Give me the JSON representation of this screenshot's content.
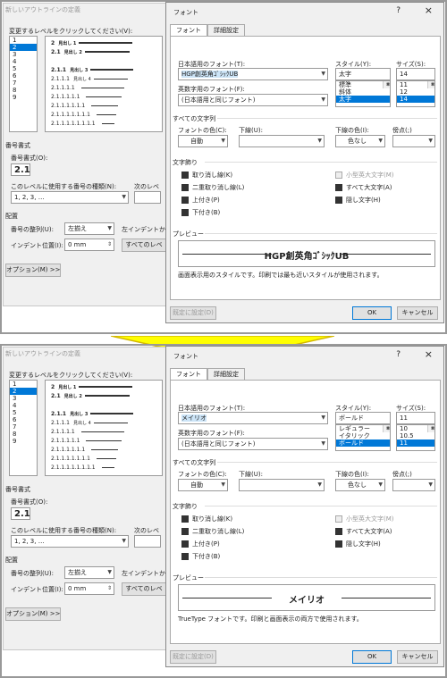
{
  "panels": [
    {
      "bg": {
        "title": "新しいアウトラインの定義",
        "level_prompt": "変更するレベルをクリックしてください(V):",
        "levels": [
          "1",
          "2",
          "3",
          "4",
          "5",
          "6",
          "7",
          "8",
          "9"
        ],
        "selected_level": 1,
        "preview_lines": [
          {
            "num": "2",
            "text": "見出し 1",
            "bold": true
          },
          {
            "num": "2.1",
            "text": "見出し 2",
            "bold": true
          },
          {
            "num": "",
            "text": "",
            "bold": false
          },
          {
            "num": "2.1.1",
            "text": "見出し 3",
            "bold": true
          },
          {
            "num": "2.1.1.1",
            "text": "見出し 4",
            "bold": false
          },
          {
            "num": "2.1.1.1.1",
            "text": "",
            "bold": false
          },
          {
            "num": "2.1.1.1.1.1",
            "text": "",
            "bold": false
          },
          {
            "num": "2.1.1.1.1.1.1",
            "text": "",
            "bold": false
          },
          {
            "num": "2.1.1.1.1.1.1.1",
            "text": "",
            "bold": false
          },
          {
            "num": "2.1.1.1.1.1.1.1.1",
            "text": "",
            "bold": false
          }
        ],
        "num_format_heading": "番号書式",
        "num_format_label": "番号書式(O):",
        "num_format_value": "2.1",
        "num_style_label": "このレベルに使用する番号の種類(N):",
        "next_level_label": "次のレベ",
        "num_style_value": "1, 2, 3, …",
        "placement_heading": "配置",
        "align_label": "番号の整列(U):",
        "align_value": "左揃え",
        "indent_from_label": "左インデントから",
        "indent_label": "インデント位置(I):",
        "indent_value": "0 mm",
        "all_levels_btn": "すべてのレベ",
        "options_btn": "オプション(M) >>"
      },
      "font": {
        "title": "フォント",
        "help": "?",
        "close": "×",
        "tabs": [
          "フォント",
          "詳細設定"
        ],
        "jp_font_label": "日本語用のフォント(T):",
        "jp_font_value": "HGP創英角ｺﾞｼｯｸUB",
        "latin_font_label": "英数字用のフォント(F):",
        "latin_font_value": "(日本語用と同じフォント)",
        "style_label": "スタイル(Y):",
        "style_value": "太字",
        "style_options": [
          "標準",
          "斜体",
          "太字"
        ],
        "style_selected": 2,
        "size_label": "サイズ(S):",
        "size_value": "14",
        "size_options": [
          "11",
          "12",
          "14"
        ],
        "size_selected": 2,
        "all_text_heading": "すべての文字列",
        "color_label": "フォントの色(C):",
        "color_value": "自動",
        "underline_label": "下線(U):",
        "underline_value": "",
        "ul_color_label": "下線の色(I):",
        "ul_color_value": "色なし",
        "emph_label": "傍点(;)",
        "emph_value": "",
        "effects_heading": "文字飾り",
        "effects": [
          {
            "label": "取り消し線(K)",
            "checked": true,
            "disabled": false
          },
          {
            "label": "二重取り消し線(L)",
            "checked": true,
            "disabled": false
          },
          {
            "label": "上付き(P)",
            "checked": true,
            "disabled": false
          },
          {
            "label": "下付き(B)",
            "checked": true,
            "disabled": false
          }
        ],
        "effects_right": [
          {
            "label": "小型英大文字(M)",
            "checked": false,
            "disabled": true
          },
          {
            "label": "すべて大文字(A)",
            "checked": true,
            "disabled": false
          },
          {
            "label": "隠し文字(H)",
            "checked": true,
            "disabled": false
          }
        ],
        "preview_heading": "プレビュー",
        "preview_text": "HGP創英角ｺﾞｼｯｸUB",
        "note": "画面表示用のスタイルです。印刷では最も近いスタイルが使用されます。",
        "default_btn": "既定に設定(D)",
        "ok_btn": "OK",
        "cancel_btn": "キャンセル"
      }
    },
    {
      "bg": {
        "title": "新しいアウトラインの定義",
        "level_prompt": "変更するレベルをクリックしてください(V):",
        "levels": [
          "1",
          "2",
          "3",
          "4",
          "5",
          "6",
          "7",
          "8",
          "9"
        ],
        "selected_level": 1,
        "preview_lines": [
          {
            "num": "2",
            "text": "見出し 1",
            "bold": true
          },
          {
            "num": "2.1",
            "text": "見出し 2",
            "bold": true
          },
          {
            "num": "",
            "text": "",
            "bold": false
          },
          {
            "num": "2.1.1",
            "text": "見出し 3",
            "bold": true
          },
          {
            "num": "2.1.1.1",
            "text": "見出し 4",
            "bold": false
          },
          {
            "num": "2.1.1.1.1",
            "text": "",
            "bold": false
          },
          {
            "num": "2.1.1.1.1.1",
            "text": "",
            "bold": false
          },
          {
            "num": "2.1.1.1.1.1.1",
            "text": "",
            "bold": false
          },
          {
            "num": "2.1.1.1.1.1.1.1",
            "text": "",
            "bold": false
          },
          {
            "num": "2.1.1.1.1.1.1.1.1",
            "text": "",
            "bold": false
          }
        ],
        "num_format_heading": "番号書式",
        "num_format_label": "番号書式(O):",
        "num_format_value": "2.1",
        "num_style_label": "このレベルに使用する番号の種類(N):",
        "next_level_label": "次のレベ",
        "num_style_value": "1, 2, 3, …",
        "placement_heading": "配置",
        "align_label": "番号の整列(U):",
        "align_value": "左揃え",
        "indent_from_label": "左インデントから",
        "indent_label": "インデント位置(I):",
        "indent_value": "0 mm",
        "all_levels_btn": "すべてのレベ",
        "options_btn": "オプション(M) >>"
      },
      "font": {
        "title": "フォント",
        "help": "?",
        "close": "×",
        "tabs": [
          "フォント",
          "詳細設定"
        ],
        "jp_font_label": "日本語用のフォント(T):",
        "jp_font_value": "メイリオ",
        "latin_font_label": "英数字用のフォント(F):",
        "latin_font_value": "(日本語用と同じフォント)",
        "style_label": "スタイル(Y):",
        "style_value": "ボールド",
        "style_options": [
          "レギュラー",
          "イタリック",
          "ボールド"
        ],
        "style_selected": 2,
        "size_label": "サイズ(S):",
        "size_value": "11",
        "size_options": [
          "10",
          "10.5",
          "11"
        ],
        "size_selected": 2,
        "all_text_heading": "すべての文字列",
        "color_label": "フォントの色(C):",
        "color_value": "自動",
        "underline_label": "下線(U):",
        "underline_value": "",
        "ul_color_label": "下線の色(I):",
        "ul_color_value": "色なし",
        "emph_label": "傍点(;)",
        "emph_value": "",
        "effects_heading": "文字飾り",
        "effects": [
          {
            "label": "取り消し線(K)",
            "checked": true,
            "disabled": false
          },
          {
            "label": "二重取り消し線(L)",
            "checked": true,
            "disabled": false
          },
          {
            "label": "上付き(P)",
            "checked": true,
            "disabled": false
          },
          {
            "label": "下付き(B)",
            "checked": true,
            "disabled": false
          }
        ],
        "effects_right": [
          {
            "label": "小型英大文字(M)",
            "checked": false,
            "disabled": true
          },
          {
            "label": "すべて大文字(A)",
            "checked": true,
            "disabled": false
          },
          {
            "label": "隠し文字(H)",
            "checked": true,
            "disabled": false
          }
        ],
        "preview_heading": "プレビュー",
        "preview_text": "メイリオ",
        "note": "TrueType フォントです。印刷と画面表示の両方で使用されます。",
        "default_btn": "既定に設定(D)",
        "ok_btn": "OK",
        "cancel_btn": "キャンセル"
      }
    }
  ],
  "colors": {
    "accent": "#0078d7",
    "arrow_fill": "#ffff00",
    "arrow_stroke": "#d4b800"
  }
}
